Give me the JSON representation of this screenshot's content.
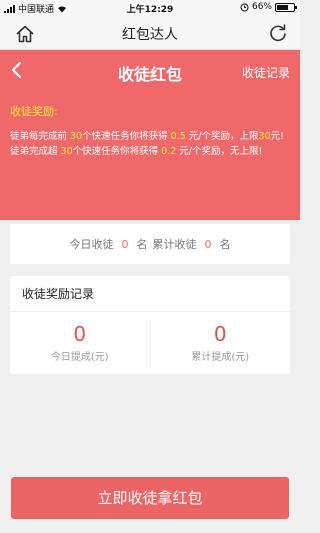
{
  "status_bar": {
    "carrier": "中国联通",
    "time": "上午12:29",
    "battery_percent": "66%",
    "battery_level": 0.66
  },
  "app_header": {
    "title": "红包达人",
    "home_icon": "home-icon",
    "refresh_icon": "refresh-icon"
  },
  "nav": {
    "back_icon": "chevron-left-icon",
    "title": "收徒红包",
    "link": "收徒记录"
  },
  "rules": {
    "heading": "收徒奖励:",
    "line1_pre": "徒弟每完成前 ",
    "line1_count": "30",
    "line1_mid": "个快速任务你将获得 ",
    "line1_amount": "0.5",
    "line1_post": " 元/个奖励，上限",
    "line1_limit": "30",
    "line1_end": "元!",
    "line2_pre": "徒弟完成超 ",
    "line2_count": "30",
    "line2_mid": "个快速任务你将获得 ",
    "line2_amount": "0.2",
    "line2_post": " 元/个奖励，无上限!"
  },
  "today_summary": {
    "today_label": "今日收徒",
    "today_count": "0",
    "unit1": "名",
    "total_label": "累计收徒",
    "total_count": "0",
    "unit2": "名"
  },
  "records": {
    "title": "收徒奖励记录",
    "today_value": "0",
    "today_label": "今日提成(元)",
    "total_value": "0",
    "total_label": "累计提成(元)"
  },
  "bottom_button": {
    "label": "立即收徒拿红包"
  },
  "colors": {
    "accent": "#f0696a",
    "highlight": "#ffeb3b"
  }
}
